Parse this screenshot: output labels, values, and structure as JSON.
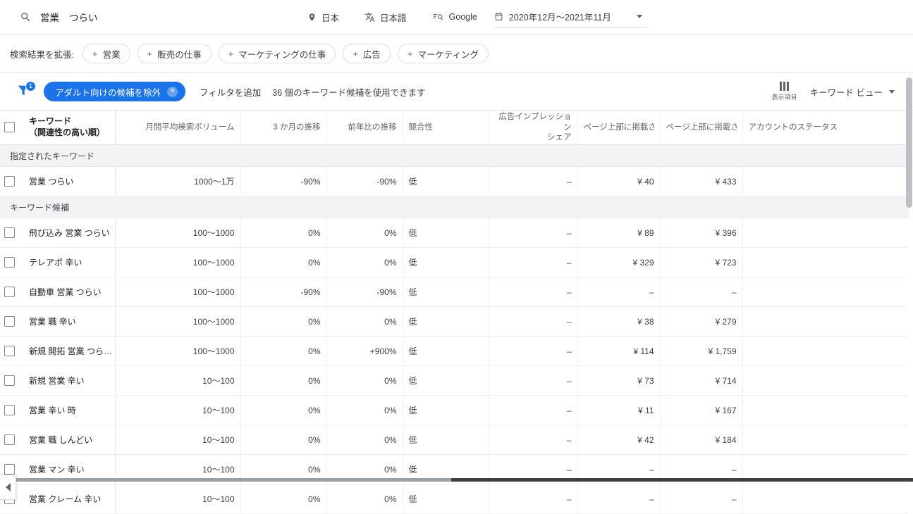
{
  "search": {
    "icon": "search-icon",
    "terms": [
      "営業",
      "つらい"
    ]
  },
  "topbar": {
    "location": {
      "icon": "location-pin-icon",
      "label": "日本"
    },
    "language": {
      "icon": "translate-icon",
      "label": "日本語"
    },
    "network": {
      "icon": "search-network-icon",
      "label": "Google"
    },
    "daterange": {
      "icon": "calendar-icon",
      "label": "2020年12月～2021年11月"
    }
  },
  "expand": {
    "label": "検索結果を拡張:",
    "chips": [
      {
        "plus": "+",
        "label": "営業"
      },
      {
        "plus": "+",
        "label": "販売の仕事"
      },
      {
        "plus": "+",
        "label": "マーケティングの仕事"
      },
      {
        "plus": "+",
        "label": "広告"
      },
      {
        "plus": "+",
        "label": "マーケティング"
      }
    ]
  },
  "filterbar": {
    "funnel_badge": "1",
    "active_filter": "アダルト向けの候補を除外",
    "active_filter_close": "✕",
    "add_filter": "フィルタを追加",
    "availability": "36 個のキーワード候補を使用できます",
    "columns_label": "表示項目",
    "view_label": "キーワード ビュー"
  },
  "table": {
    "headers": [
      "キーワード",
      "（関連性の高い順）",
      "月間平均検索ボリューム",
      "3 か月の推移",
      "前年比の推移",
      "競合性",
      "広告インプレッション",
      "シェア",
      "ページ上部に掲載さ�",
      "ページ上部に掲載さ�",
      "アカウントのステータス"
    ],
    "groups": [
      {
        "label": "指定されたキーワード",
        "rows": [
          {
            "keyword": "営業 つらい",
            "volume": "1000～1万",
            "change3m": "-90%",
            "changeyoy": "-90%",
            "competition": "低",
            "impr_share": "–",
            "top_low": "¥ 40",
            "top_high": "¥ 433",
            "account_status": ""
          }
        ]
      },
      {
        "label": "キーワード候補",
        "rows": [
          {
            "keyword": "飛び込み 営業 つらい",
            "volume": "100～1000",
            "change3m": "0%",
            "changeyoy": "0%",
            "competition": "低",
            "impr_share": "–",
            "top_low": "¥ 89",
            "top_high": "¥ 396",
            "account_status": ""
          },
          {
            "keyword": "テレアポ 辛い",
            "volume": "100～1000",
            "change3m": "0%",
            "changeyoy": "0%",
            "competition": "低",
            "impr_share": "–",
            "top_low": "¥ 329",
            "top_high": "¥ 723",
            "account_status": ""
          },
          {
            "keyword": "自動車 営業 つらい",
            "volume": "100～1000",
            "change3m": "-90%",
            "changeyoy": "-90%",
            "competition": "低",
            "impr_share": "–",
            "top_low": "–",
            "top_high": "–",
            "account_status": ""
          },
          {
            "keyword": "営業 職 辛い",
            "volume": "100～1000",
            "change3m": "0%",
            "changeyoy": "0%",
            "competition": "低",
            "impr_share": "–",
            "top_low": "¥ 38",
            "top_high": "¥ 279",
            "account_status": ""
          },
          {
            "keyword": "新規 開拓 営業 つら…",
            "volume": "100～1000",
            "change3m": "0%",
            "changeyoy": "+900%",
            "competition": "低",
            "impr_share": "–",
            "top_low": "¥ 114",
            "top_high": "¥ 1,759",
            "account_status": ""
          },
          {
            "keyword": "新規 営業 辛い",
            "volume": "10～100",
            "change3m": "0%",
            "changeyoy": "0%",
            "competition": "低",
            "impr_share": "–",
            "top_low": "¥ 73",
            "top_high": "¥ 714",
            "account_status": ""
          },
          {
            "keyword": "営業 辛い 時",
            "volume": "10～100",
            "change3m": "0%",
            "changeyoy": "0%",
            "competition": "低",
            "impr_share": "–",
            "top_low": "¥ 11",
            "top_high": "¥ 167",
            "account_status": ""
          },
          {
            "keyword": "営業 職 しんどい",
            "volume": "10～100",
            "change3m": "0%",
            "changeyoy": "0%",
            "competition": "低",
            "impr_share": "–",
            "top_low": "¥ 42",
            "top_high": "¥ 184",
            "account_status": ""
          },
          {
            "keyword": "営業 マン 辛い",
            "volume": "10～100",
            "change3m": "0%",
            "changeyoy": "0%",
            "competition": "低",
            "impr_share": "–",
            "top_low": "–",
            "top_high": "–",
            "account_status": ""
          },
          {
            "keyword": "営業 クレーム 辛い",
            "volume": "10～100",
            "change3m": "0%",
            "changeyoy": "0%",
            "competition": "低",
            "impr_share": "–",
            "top_low": "–",
            "top_high": "–",
            "account_status": ""
          }
        ]
      }
    ]
  },
  "colors": {
    "accent": "#1a73e8",
    "text": "#3c4043",
    "muted": "#5f6368",
    "group_bg": "#f1f3f4",
    "border": "#e0e0e0"
  }
}
